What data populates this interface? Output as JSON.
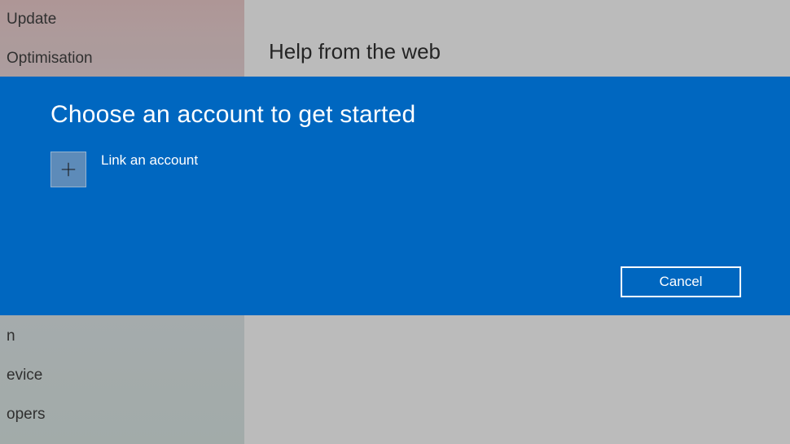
{
  "sidebar": {
    "items": [
      {
        "label": "Update"
      },
      {
        "label": "Optimisation"
      },
      {
        "label": "n"
      },
      {
        "label": "evice"
      },
      {
        "label": "opers"
      }
    ]
  },
  "main": {
    "heading": "Help from the web"
  },
  "dialog": {
    "title": "Choose an account to get started",
    "link_account_label": "Link an account",
    "cancel_label": "Cancel"
  }
}
